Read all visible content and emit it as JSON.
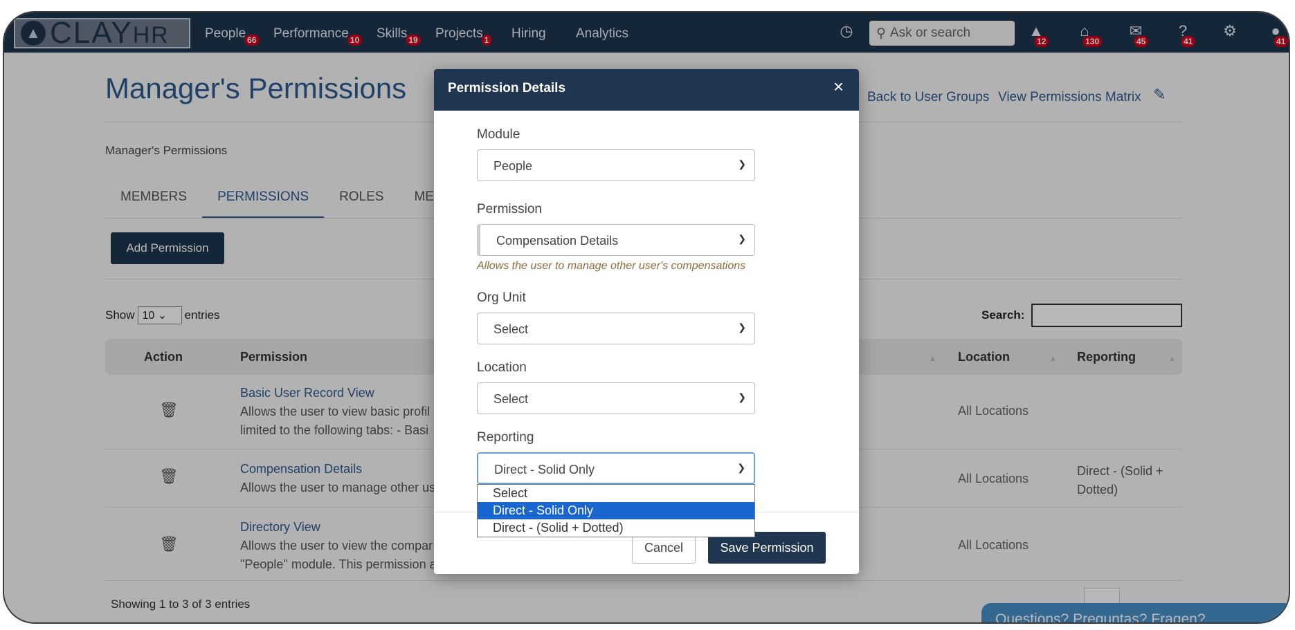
{
  "nav": {
    "logo_text": "CLAY",
    "logo_suffix": "HR",
    "items": [
      {
        "label": "People",
        "badge": "66"
      },
      {
        "label": "Performance",
        "badge": "10"
      },
      {
        "label": "Skills",
        "badge": "19"
      },
      {
        "label": "Projects",
        "badge": "1"
      },
      {
        "label": "Hiring",
        "badge": ""
      },
      {
        "label": "Analytics",
        "badge": ""
      }
    ],
    "search_placeholder": "Ask or search",
    "icon_badges": {
      "learning": "12",
      "home": "130",
      "mail": "45",
      "help": "41",
      "profile": "41"
    }
  },
  "page": {
    "title": "Manager's Permissions",
    "breadcrumb": "Manager's Permissions",
    "back_link": "Back to User Groups",
    "matrix_link": "View Permissions Matrix",
    "tabs": [
      "MEMBERS",
      "PERMISSIONS",
      "ROLES",
      "MEM"
    ],
    "add_button": "Add Permission",
    "show_label": "Show",
    "entries_value": "10",
    "entries_label": "entries",
    "search_label": "Search:",
    "columns": {
      "action": "Action",
      "permission": "Permission",
      "location": "Location",
      "reporting": "Reporting"
    },
    "rows": [
      {
        "title": "Basic User Record View",
        "desc1": "Allows the user to view basic profil",
        "desc2": "limited to the following tabs: - Basi",
        "location": "All Locations",
        "reporting1": "",
        "reporting2": ""
      },
      {
        "title": "Compensation Details",
        "desc1": "Allows the user to manage other us",
        "desc2": "",
        "location": "All Locations",
        "reporting1": "Direct - (Solid +",
        "reporting2": "Dotted)"
      },
      {
        "title": "Directory View",
        "desc1": "Allows the user to view the compar",
        "desc2": "\"People\" module. This permission a",
        "location": "All Locations",
        "reporting1": "",
        "reporting2": ""
      }
    ],
    "showing": "Showing 1 to 3 of 3 entries",
    "help_text": "Questions? Preguntas? Fragen?"
  },
  "modal": {
    "title": "Permission Details",
    "close": "×",
    "module_label": "Module",
    "module_value": "People",
    "permission_label": "Permission",
    "permission_value": "Compensation Details",
    "permission_hint": "Allows the user to manage other user's compensations",
    "org_label": "Org Unit",
    "org_value": "Select",
    "location_label": "Location",
    "location_value": "Select",
    "reporting_label": "Reporting",
    "reporting_value": "Direct - Solid Only",
    "reporting_options": [
      "Select",
      "Direct - Solid Only",
      "Direct - (Solid + Dotted)"
    ],
    "cancel": "Cancel",
    "save": "Save Permission"
  }
}
